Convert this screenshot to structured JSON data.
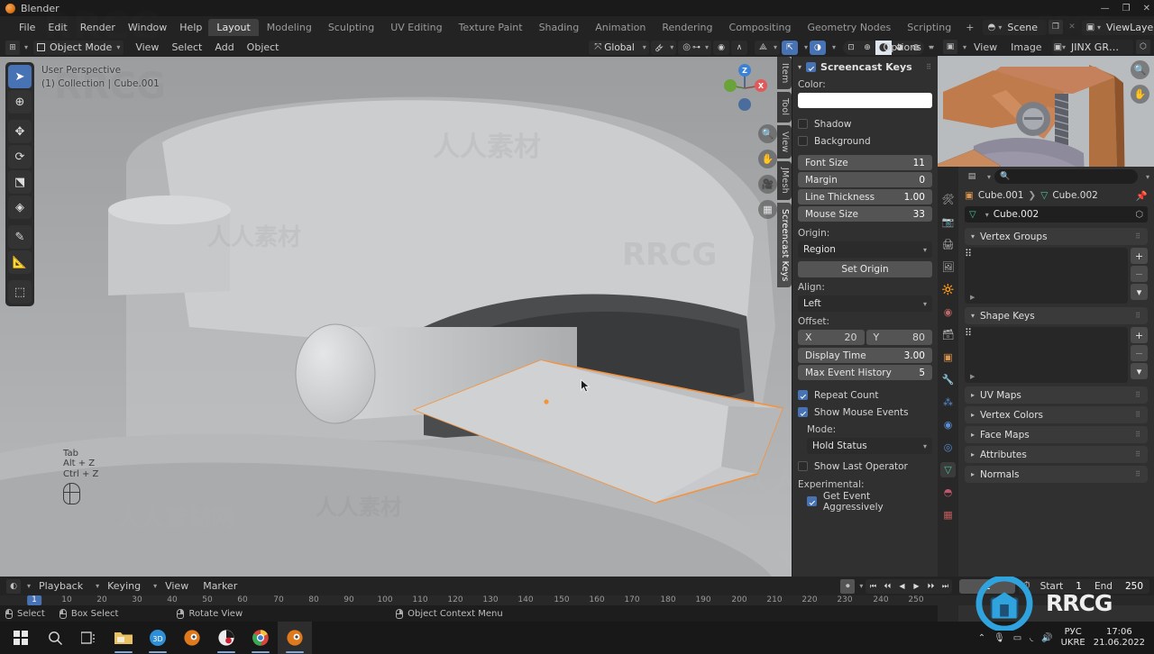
{
  "window": {
    "title": "Blender",
    "controls": [
      "—",
      "❐",
      "✕"
    ]
  },
  "topbar": {
    "menus": [
      "File",
      "Edit",
      "Render",
      "Window",
      "Help"
    ],
    "workspaces": [
      "Layout",
      "Modeling",
      "Sculpting",
      "UV Editing",
      "Texture Paint",
      "Shading",
      "Animation",
      "Rendering",
      "Compositing",
      "Geometry Nodes",
      "Scripting"
    ],
    "active_workspace": "Layout",
    "add_workspace": "+",
    "scene_label": "Scene",
    "viewlayer_label": "ViewLayer",
    "scene_icon": "scene-icon",
    "viewlayer_icon": "viewlayer-icon"
  },
  "viewport": {
    "mode": "Object Mode",
    "menus": [
      "View",
      "Select",
      "Add",
      "Object"
    ],
    "transform_orientation": "Global",
    "options_label": "Options",
    "overlay_line1": "User Perspective",
    "overlay_line2": "(1) Collection | Cube.001",
    "screencast_keys": [
      "Tab",
      "Alt + Z",
      "Ctrl + Z"
    ],
    "gizmo_axes": [
      "Z",
      "X"
    ],
    "tools": [
      "tweak-select-box-tool",
      "cursor-tool",
      "move-tool",
      "rotate-tool",
      "scale-tool",
      "transform-tool",
      "annotate-tool",
      "measure-tool",
      "add-cube-tool"
    ],
    "nav_buttons": [
      "zoom-icon",
      "hand-pan-icon",
      "camera-view-icon",
      "toggle-perspective-icon"
    ]
  },
  "sidebar": {
    "tabs": [
      "Item",
      "Tool",
      "View",
      "JMesh",
      "Screencast Keys"
    ],
    "active_tab": "Screencast Keys",
    "panel": {
      "title": "Screencast Keys",
      "enabled": true,
      "color_label": "Color:",
      "color_value": "#ffffff",
      "shadow_label": "Shadow",
      "shadow_checked": false,
      "background_label": "Background",
      "background_checked": false,
      "numbers": [
        {
          "name": "Font Size",
          "value": "11"
        },
        {
          "name": "Margin",
          "value": "0"
        },
        {
          "name": "Line Thickness",
          "value": "1.00"
        },
        {
          "name": "Mouse Size",
          "value": "33"
        }
      ],
      "origin_label": "Origin:",
      "origin_value": "Region",
      "set_origin_label": "Set Origin",
      "align_label": "Align:",
      "align_value": "Left",
      "offset_label": "Offset:",
      "offset_x_name": "X",
      "offset_x_value": "20",
      "offset_y_name": "Y",
      "offset_y_value": "80",
      "display_time_name": "Display Time",
      "display_time_value": "3.00",
      "max_event_name": "Max Event History",
      "max_event_value": "5",
      "repeat_count_label": "Repeat Count",
      "repeat_count_checked": true,
      "show_mouse_label": "Show Mouse Events",
      "show_mouse_checked": true,
      "mode_label": "Mode:",
      "mode_value": "Hold Status",
      "show_last_op_label": "Show Last Operator",
      "show_last_op_checked": false,
      "experimental_label": "Experimental:",
      "get_event_label": "Get Event Aggressively",
      "get_event_checked": true
    }
  },
  "image_editor": {
    "menus": [
      "View",
      "Image"
    ],
    "image_name": "JINX GRENADE.jpeg",
    "nav_buttons": [
      "zoom-icon",
      "hand-pan-icon"
    ]
  },
  "properties": {
    "search_placeholder": "",
    "search_icon": "search-icon",
    "breadcrumb": [
      "Cube.001",
      "Cube.002"
    ],
    "object_name": "Cube.002",
    "tabs": [
      "tool-properties-tab",
      "render-properties-tab",
      "output-properties-tab",
      "view-layer-properties-tab",
      "scene-properties-tab",
      "world-properties-tab",
      "collection-properties-tab",
      "object-properties-tab",
      "modifier-properties-tab",
      "particles-properties-tab",
      "physics-properties-tab",
      "constraints-properties-tab",
      "object-data-properties-tab",
      "material-properties-tab",
      "texture-properties-tab"
    ],
    "active_tab": "object-data-properties-tab",
    "panels": [
      {
        "title": "Vertex Groups",
        "open": true,
        "has_list": true
      },
      {
        "title": "Shape Keys",
        "open": true,
        "has_list": true
      },
      {
        "title": "UV Maps",
        "open": false,
        "has_list": false
      },
      {
        "title": "Vertex Colors",
        "open": false,
        "has_list": false
      },
      {
        "title": "Face Maps",
        "open": false,
        "has_list": false
      },
      {
        "title": "Attributes",
        "open": false,
        "has_list": false
      },
      {
        "title": "Normals",
        "open": false,
        "has_list": false
      }
    ],
    "list_add_label": "+",
    "list_remove_label": "−",
    "list_menu_icon": "chevron-down-icon"
  },
  "timeline": {
    "menus": [
      "Playback",
      "Keying",
      "View",
      "Marker"
    ],
    "record_icon": "record-icon",
    "playback_buttons": [
      "jump-start-icon",
      "prev-keyframe-icon",
      "play-reverse-icon",
      "play-icon",
      "next-keyframe-icon",
      "jump-end-icon"
    ],
    "current_frame": "1",
    "timer_icon": "stopwatch-icon",
    "start_label": "Start",
    "start_value": "1",
    "end_label": "End",
    "end_value": "250",
    "ticks": [
      "1",
      "10",
      "20",
      "30",
      "40",
      "50",
      "60",
      "70",
      "80",
      "90",
      "100",
      "110",
      "120",
      "130",
      "140",
      "150",
      "160",
      "170",
      "180",
      "190",
      "200",
      "210",
      "220",
      "230",
      "240",
      "250"
    ],
    "playhead_frame": "1"
  },
  "statusbar": {
    "items": [
      {
        "mouse": "left",
        "label": "Select"
      },
      {
        "mouse": "left-drag",
        "label": "Box Select"
      },
      {
        "mouse": "middle",
        "label": "Rotate View"
      },
      {
        "mouse": "right",
        "label": "Object Context Menu"
      }
    ]
  },
  "taskbar": {
    "items": [
      "windows-start-icon",
      "search-icon",
      "task-view-icon",
      "file-explorer-icon",
      "3d-viewer-icon",
      "blender-icon",
      "substance-painter-icon",
      "chrome-icon",
      "blender-icon-active"
    ],
    "tray": [
      "show-hidden-icon",
      "microphone-icon",
      "battery-icon",
      "wifi-icon",
      "volume-icon"
    ],
    "language_line1": "РУС",
    "language_line2": "UKRE",
    "time": "17:06",
    "date": "21.06.2022"
  },
  "watermarks": {
    "brand": "RRCG",
    "cn1": "人人素材",
    "cn2": "人人素材网"
  },
  "colors": {
    "accent_blue": "#4772b3",
    "header_bg": "#232323",
    "panel_bg": "#303030",
    "viewport_bg": "#a8aaac",
    "selected_outline": "#f5923c",
    "window_bg": "#1d1d1d"
  }
}
